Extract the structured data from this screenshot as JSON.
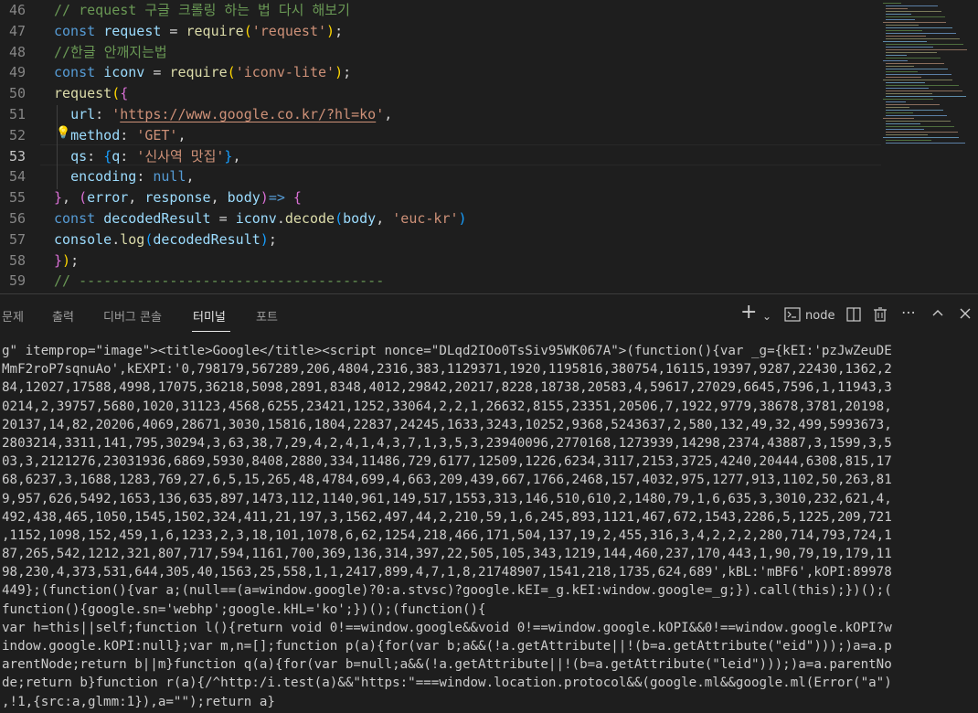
{
  "editor": {
    "lines": [
      {
        "num": "46",
        "tokens": [
          [
            "c",
            "// request 구글 크롤링 하는 법 다시 해보기"
          ]
        ]
      },
      {
        "num": "47",
        "tokens": [
          [
            "k",
            "const "
          ],
          [
            "v",
            "request"
          ],
          [
            "p",
            " = "
          ],
          [
            "f",
            "require"
          ],
          [
            "b1",
            "("
          ],
          [
            "s",
            "'request'"
          ],
          [
            "b1",
            ")"
          ],
          [
            "p",
            ";"
          ]
        ]
      },
      {
        "num": "48",
        "tokens": [
          [
            "c",
            "//한글 안깨지는법"
          ]
        ]
      },
      {
        "num": "49",
        "tokens": [
          [
            "k",
            "const "
          ],
          [
            "v",
            "iconv"
          ],
          [
            "p",
            " = "
          ],
          [
            "f",
            "require"
          ],
          [
            "b1",
            "("
          ],
          [
            "s",
            "'iconv-lite'"
          ],
          [
            "b1",
            ")"
          ],
          [
            "p",
            ";"
          ]
        ]
      },
      {
        "num": "50",
        "tokens": [
          [
            "f",
            "request"
          ],
          [
            "b1",
            "("
          ],
          [
            "b2",
            "{"
          ]
        ]
      },
      {
        "num": "51",
        "tokens": [
          [
            "p",
            "  "
          ],
          [
            "v",
            "url"
          ],
          [
            "p",
            ": "
          ],
          [
            "s",
            "'"
          ],
          [
            "s u",
            "https://www.google.co.kr/?hl=ko"
          ],
          [
            "s",
            "'"
          ],
          [
            "p",
            ","
          ]
        ]
      },
      {
        "num": "52",
        "tokens": [
          [
            "p",
            "  "
          ],
          [
            "v",
            "method"
          ],
          [
            "p",
            ": "
          ],
          [
            "s",
            "'GET'"
          ],
          [
            "p",
            ","
          ]
        ]
      },
      {
        "num": "53",
        "tokens": [
          [
            "p",
            "  "
          ],
          [
            "v",
            "qs"
          ],
          [
            "p",
            ": "
          ],
          [
            "b3",
            "{"
          ],
          [
            "v",
            "q"
          ],
          [
            "p",
            ": "
          ],
          [
            "s",
            "'신사역 맛집'"
          ],
          [
            "b3",
            "}"
          ],
          [
            "p",
            ","
          ]
        ]
      },
      {
        "num": "54",
        "tokens": [
          [
            "p",
            "  "
          ],
          [
            "v",
            "encoding"
          ],
          [
            "p",
            ": "
          ],
          [
            "k",
            "null"
          ],
          [
            "p",
            ","
          ]
        ]
      },
      {
        "num": "55",
        "tokens": [
          [
            "b2",
            "}"
          ],
          [
            "p",
            ", "
          ],
          [
            "b2",
            "("
          ],
          [
            "v",
            "error"
          ],
          [
            "p",
            ", "
          ],
          [
            "v",
            "response"
          ],
          [
            "p",
            ", "
          ],
          [
            "v",
            "body"
          ],
          [
            "b2",
            ")"
          ],
          [
            "k",
            "=>"
          ],
          [
            "p",
            " "
          ],
          [
            "b2",
            "{"
          ]
        ]
      },
      {
        "num": "56",
        "tokens": [
          [
            "k",
            "const "
          ],
          [
            "v",
            "decodedResult"
          ],
          [
            "p",
            " = "
          ],
          [
            "v",
            "iconv"
          ],
          [
            "p",
            "."
          ],
          [
            "f",
            "decode"
          ],
          [
            "b3",
            "("
          ],
          [
            "v",
            "body"
          ],
          [
            "p",
            ", "
          ],
          [
            "s",
            "'euc-kr'"
          ],
          [
            "b3",
            ")"
          ]
        ]
      },
      {
        "num": "57",
        "tokens": [
          [
            "v",
            "console"
          ],
          [
            "p",
            "."
          ],
          [
            "f",
            "log"
          ],
          [
            "b3",
            "("
          ],
          [
            "v",
            "decodedResult"
          ],
          [
            "b3",
            ")"
          ],
          [
            "p",
            ";"
          ]
        ]
      },
      {
        "num": "58",
        "tokens": [
          [
            "b2",
            "}"
          ],
          [
            "b1",
            ")"
          ],
          [
            "p",
            ";"
          ]
        ]
      },
      {
        "num": "59",
        "tokens": [
          [
            "c",
            "// -------------------------------------"
          ]
        ]
      }
    ],
    "active_line": "53"
  },
  "panel": {
    "tabs": [
      "문제",
      "출력",
      "디버그 콘솔",
      "터미널",
      "포트"
    ],
    "active_tab": "터미널",
    "terminal_name": "node",
    "icons": [
      "plus-icon",
      "chevron-down-icon",
      "terminal-icon",
      "split-icon",
      "trash-icon",
      "more-icon",
      "chevron-up-icon",
      "close-icon"
    ]
  },
  "terminal": {
    "lines": [
      "g\" itemprop=\"image\"><title>Google</title><script nonce=\"DLqd2IOo0TsSiv95WK067A\">(function(){var _g={kEI:'pzJwZeuDE",
      "MmF2roP7sqnuAo',kEXPI:'0,798179,567289,206,4804,2316,383,1129371,1920,1195816,380754,16115,19397,9287,22430,1362,2",
      "84,12027,17588,4998,17075,36218,5098,2891,8348,4012,29842,20217,8228,18738,20583,4,59617,27029,6645,7596,1,11943,3",
      "0214,2,39757,5680,1020,31123,4568,6255,23421,1252,33064,2,2,1,26632,8155,23351,20506,7,1922,9779,38678,3781,20198,",
      "20137,14,82,20206,4069,28671,3030,15816,1804,22837,24245,1633,3243,10252,9368,5243637,2,580,132,49,32,499,5993673,",
      "2803214,3311,141,795,30294,3,63,38,7,29,4,2,4,1,4,3,7,1,3,5,3,23940096,2770168,1273939,14298,2374,43887,3,1599,3,5",
      "03,3,2121276,23031936,6869,5930,8408,2880,334,11486,729,6177,12509,1226,6234,3117,2153,3725,4240,20444,6308,815,17",
      "68,6237,3,1688,1283,769,27,6,5,15,265,48,4784,699,4,663,209,439,667,1766,2468,157,4032,975,1277,913,1102,50,263,81",
      "9,957,626,5492,1653,136,635,897,1473,112,1140,961,149,517,1553,313,146,510,610,2,1480,79,1,6,635,3,3010,232,621,4,",
      "492,438,465,1050,1545,1502,324,411,21,197,3,1562,497,44,2,210,59,1,6,245,893,1121,467,672,1543,2286,5,1225,209,721",
      ",1152,1098,152,459,1,6,1233,2,3,18,101,1078,6,62,1254,218,466,171,504,137,19,2,455,316,3,4,2,2,2,280,714,793,724,1",
      "87,265,542,1212,321,807,717,594,1161,700,369,136,314,397,22,505,105,343,1219,144,460,237,170,443,1,90,79,19,179,11",
      "98,230,4,373,531,644,305,40,1563,25,558,1,1,2417,899,4,7,1,8,21748907,1541,218,1735,624,689',kBL:'mBF6',kOPI:89978",
      "449};(function(){var a;(null==(a=window.google)?0:a.stvsc)?google.kEI=_g.kEI:window.google=_g;}).call(this);})();(",
      "function(){google.sn='webhp';google.kHL='ko';})();(function(){",
      "var h=this||self;function l(){return void 0!==window.google&&void 0!==window.google.kOPI&&0!==window.google.kOPI?w",
      "indow.google.kOPI:null};var m,n=[];function p(a){for(var b;a&&(!a.getAttribute||!(b=a.getAttribute(\"eid\")));)a=a.p",
      "arentNode;return b||m}function q(a){for(var b=null;a&&(!a.getAttribute||!(b=a.getAttribute(\"leid\")));)a=a.parentNo",
      "de;return b}function r(a){/^http:/i.test(a)&&\"https:\"===window.location.protocol&&(google.ml&&google.ml(Error(\"a\")",
      ",!1,{src:a,glmm:1}),a=\"\");return a}"
    ]
  }
}
